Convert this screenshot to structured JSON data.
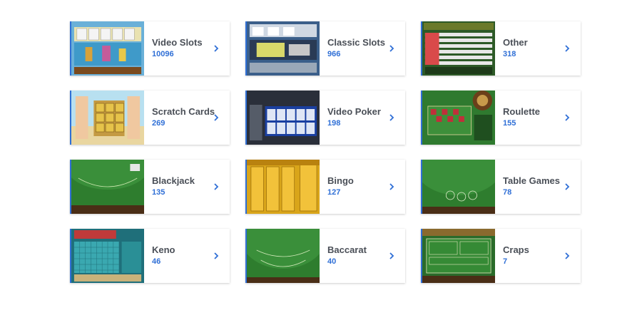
{
  "categories": [
    {
      "title": "Video Slots",
      "count": "10096",
      "thumb": "video-slots"
    },
    {
      "title": "Classic Slots",
      "count": "966",
      "thumb": "classic-slots"
    },
    {
      "title": "Other",
      "count": "318",
      "thumb": "other"
    },
    {
      "title": "Scratch Cards",
      "count": "269",
      "thumb": "scratch-cards"
    },
    {
      "title": "Video Poker",
      "count": "198",
      "thumb": "video-poker"
    },
    {
      "title": "Roulette",
      "count": "155",
      "thumb": "roulette"
    },
    {
      "title": "Blackjack",
      "count": "135",
      "thumb": "blackjack"
    },
    {
      "title": "Bingo",
      "count": "127",
      "thumb": "bingo"
    },
    {
      "title": "Table Games",
      "count": "78",
      "thumb": "table-games"
    },
    {
      "title": "Keno",
      "count": "46",
      "thumb": "keno"
    },
    {
      "title": "Baccarat",
      "count": "40",
      "thumb": "baccarat"
    },
    {
      "title": "Craps",
      "count": "7",
      "thumb": "craps"
    }
  ],
  "colors": {
    "accent": "#2f6fd6",
    "title": "#4a4f57",
    "felt": "#2e7d2e"
  },
  "icons": {
    "arrow": "chevron-right-icon"
  }
}
